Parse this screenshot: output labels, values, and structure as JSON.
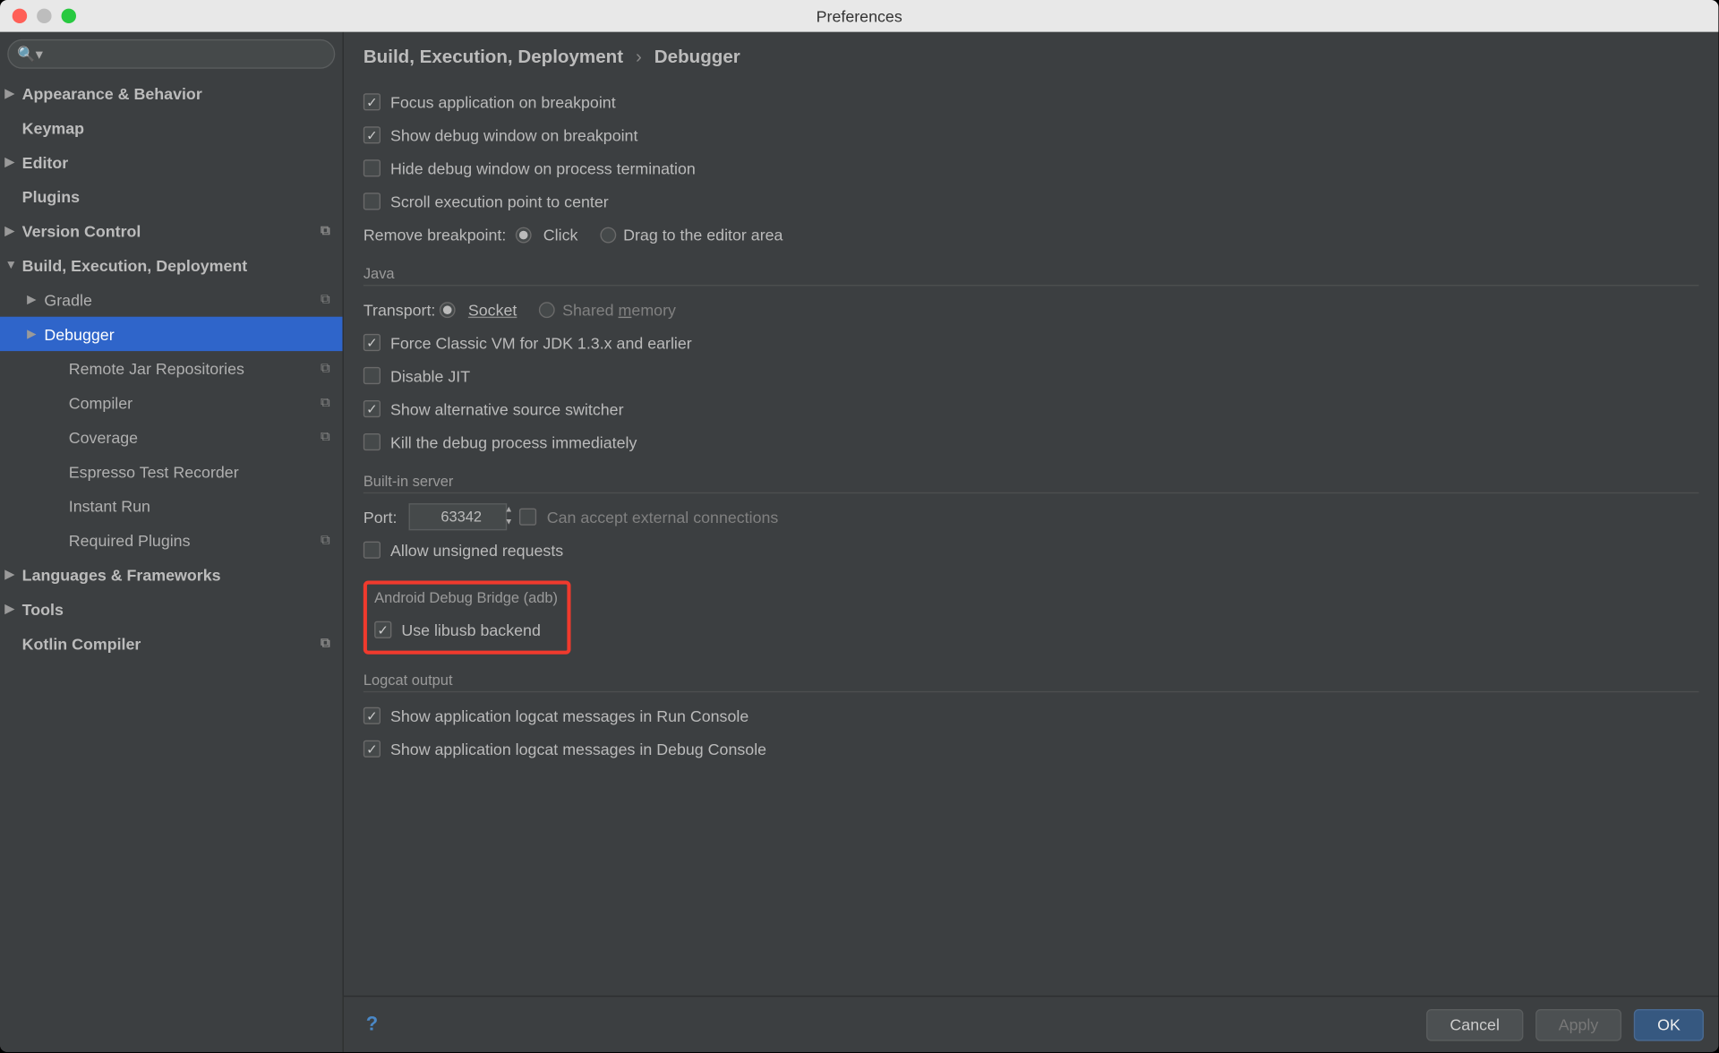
{
  "window": {
    "title": "Preferences"
  },
  "search": {
    "placeholder": ""
  },
  "sidebar": [
    {
      "label": "Appearance & Behavior",
      "bold": true,
      "arrow": "▶",
      "lvl": 0
    },
    {
      "label": "Keymap",
      "bold": true,
      "lvl": 0
    },
    {
      "label": "Editor",
      "bold": true,
      "arrow": "▶",
      "lvl": 0
    },
    {
      "label": "Plugins",
      "bold": true,
      "lvl": 0
    },
    {
      "label": "Version Control",
      "bold": true,
      "arrow": "▶",
      "lvl": 0,
      "copy": true
    },
    {
      "label": "Build, Execution, Deployment",
      "bold": true,
      "arrow": "▼",
      "lvl": 0
    },
    {
      "label": "Gradle",
      "arrow": "▶",
      "lvl": 1,
      "copy": true
    },
    {
      "label": "Debugger",
      "arrow": "▶",
      "lvl": 1,
      "sel": true
    },
    {
      "label": "Remote Jar Repositories",
      "lvl": 2,
      "copy": true
    },
    {
      "label": "Compiler",
      "lvl": 2,
      "copy": true
    },
    {
      "label": "Coverage",
      "lvl": 2,
      "copy": true
    },
    {
      "label": "Espresso Test Recorder",
      "lvl": 2
    },
    {
      "label": "Instant Run",
      "lvl": 2
    },
    {
      "label": "Required Plugins",
      "lvl": 2,
      "copy": true
    },
    {
      "label": "Languages & Frameworks",
      "bold": true,
      "arrow": "▶",
      "lvl": 0
    },
    {
      "label": "Tools",
      "bold": true,
      "arrow": "▶",
      "lvl": 0
    },
    {
      "label": "Kotlin Compiler",
      "bold": true,
      "lvl": 0,
      "copy": true
    }
  ],
  "crumb": {
    "a": "Build, Execution, Deployment",
    "b": "Debugger"
  },
  "top": {
    "c1": "Focus application on breakpoint",
    "c2": "Show debug window on breakpoint",
    "c3": "Hide debug window on process termination",
    "c4": "Scroll execution point to center",
    "rbLabel": "Remove breakpoint:",
    "r1": "Click",
    "r2": "Drag to the editor area"
  },
  "java": {
    "title": "Java",
    "tlabel": "Transport:",
    "r1": "Socket",
    "r2": "Shared memory",
    "c1": "Force Classic VM for JDK 1.3.x and earlier",
    "c2": "Disable JIT",
    "c3": "Show alternative source switcher",
    "c4": "Kill the debug process immediately"
  },
  "server": {
    "title": "Built-in server",
    "portLabel": "Port:",
    "port": "63342",
    "c1": "Can accept external connections",
    "c2": "Allow unsigned requests"
  },
  "adb": {
    "title": "Android Debug Bridge (adb)",
    "c1": "Use libusb backend"
  },
  "logcat": {
    "title": "Logcat output",
    "c1": "Show application logcat messages in Run Console",
    "c2": "Show application logcat messages in Debug Console"
  },
  "footer": {
    "cancel": "Cancel",
    "apply": "Apply",
    "ok": "OK"
  }
}
